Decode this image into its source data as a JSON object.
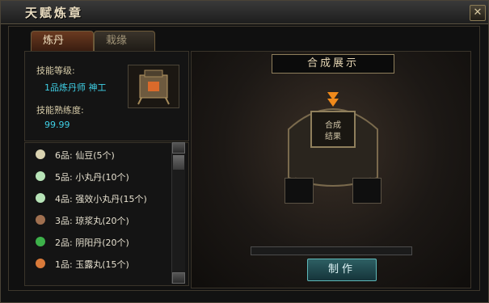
{
  "window": {
    "title": "天赋炼章",
    "close_label": "✕"
  },
  "tabs": [
    {
      "label": "炼丹",
      "active": true
    },
    {
      "label": "栽缘",
      "active": false
    }
  ],
  "skill": {
    "level_label": "技能等级:",
    "level_value": "1品炼丹师 神工",
    "proficiency_label": "技能熟练度:",
    "proficiency_value": "99.99"
  },
  "recipes": [
    {
      "label": "6品: 仙豆(5个)",
      "icon": "bean-icon",
      "color": "#d9d2b0"
    },
    {
      "label": "5品: 小丸丹(10个)",
      "icon": "potion-icon",
      "color": "#b7e3b7"
    },
    {
      "label": "4品: 强效小丸丹(15个)",
      "icon": "potion-icon",
      "color": "#b7e3b7"
    },
    {
      "label": "3品: 琼浆丸(20个)",
      "icon": "pill-icon",
      "color": "#a07050"
    },
    {
      "label": "2品: 阴阳丹(20个)",
      "icon": "pill-icon",
      "color": "#3db14a"
    },
    {
      "label": "1品: 玉露丸(15个)",
      "icon": "pill-icon",
      "color": "#d97a3a"
    }
  ],
  "showcase": {
    "title": "合成展示",
    "center_text": "合成\n结果"
  },
  "progress": 0,
  "make_button": {
    "label": "制作"
  },
  "colors": {
    "accent_cyan": "#3fd0e6",
    "text_gold": "#d7cca9"
  }
}
